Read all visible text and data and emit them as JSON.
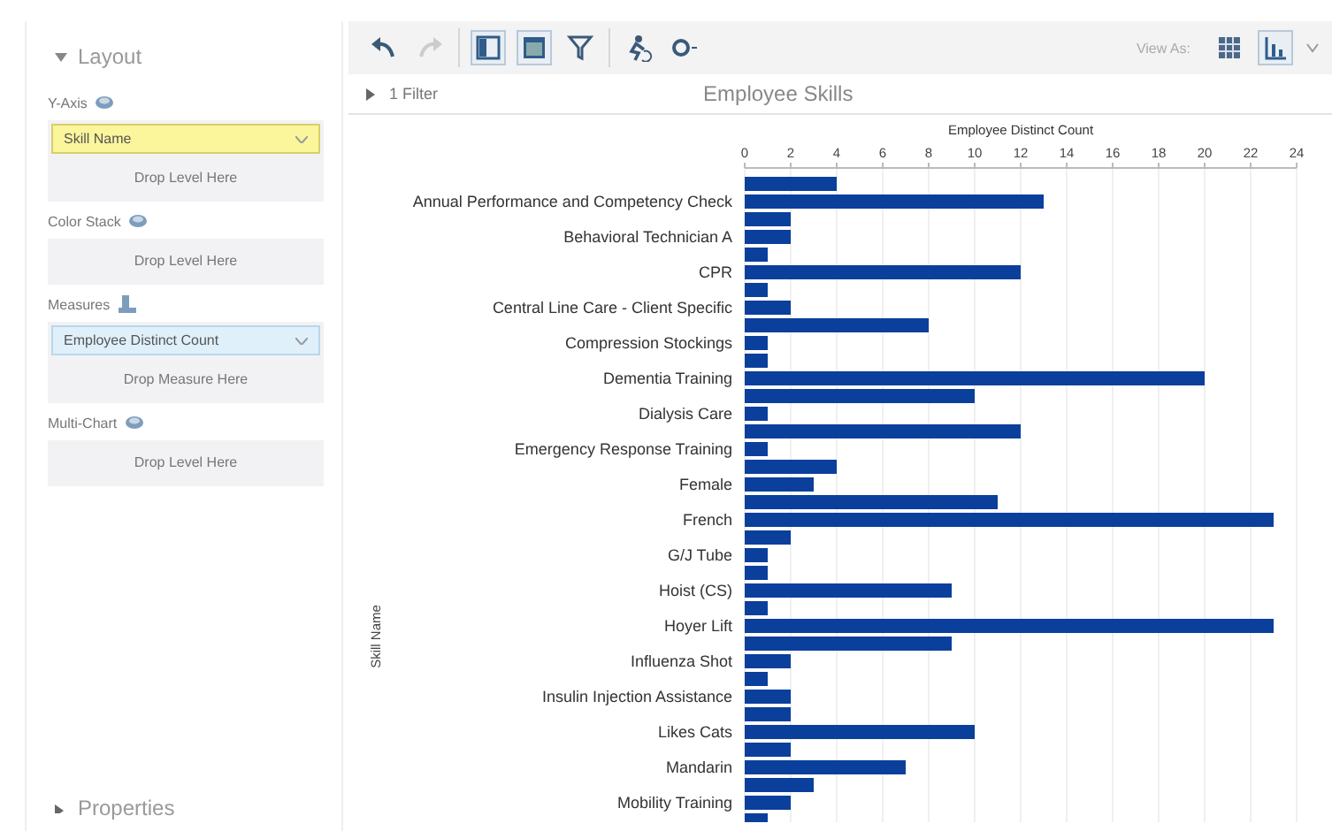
{
  "layout_panel": {
    "title": "Layout",
    "expanded": true,
    "sections": [
      {
        "label": "Y-Axis",
        "kind": "level",
        "items": [
          {
            "label": "Skill Name",
            "kind": "level"
          }
        ],
        "drop_text": "Drop Level Here"
      },
      {
        "label": "Color Stack",
        "kind": "level",
        "drop_text": "Drop Level Here"
      },
      {
        "label": "Measures",
        "kind": "measure",
        "items": [
          {
            "label": "Employee Distinct Count",
            "kind": "measure"
          }
        ],
        "drop_text": "Drop Measure Here"
      },
      {
        "label": "Multi-Chart",
        "kind": "level",
        "drop_text": "Drop Level Here"
      }
    ]
  },
  "properties_panel": {
    "title": "Properties",
    "expanded": false
  },
  "toolbar": {
    "buttons": [
      {
        "kind": "undo",
        "disabled": false,
        "on": false
      },
      {
        "kind": "redo",
        "disabled": true,
        "on": false
      },
      {
        "kind": "sep"
      },
      {
        "kind": "panel",
        "disabled": false,
        "on": true
      },
      {
        "kind": "table",
        "disabled": false,
        "on": true
      },
      {
        "kind": "filter",
        "disabled": false,
        "on": false
      },
      {
        "kind": "sep"
      },
      {
        "kind": "run",
        "disabled": false,
        "on": false
      },
      {
        "kind": "gear",
        "disabled": false,
        "on": false
      }
    ],
    "view_as": "View As:",
    "views": [
      {
        "kind": "grid",
        "selected": false
      },
      {
        "kind": "bar",
        "selected": true
      }
    ]
  },
  "filter_bar": {
    "label": "1 Filter",
    "expanded": false
  },
  "chart_data": {
    "type": "bar",
    "orientation": "horizontal",
    "title": "Employee Skills",
    "xlabel": "Employee Distinct Count",
    "ylabel": "Skill Name",
    "categories": [
      null,
      "Annual Performance and Competency Check",
      null,
      "Behavioral Technician A",
      null,
      "CPR",
      null,
      "Central Line Care - Client Specific",
      null,
      "Compression Stockings",
      null,
      "Dementia Training",
      null,
      "Dialysis Care",
      null,
      "Emergency Response Training",
      null,
      "Female",
      null,
      "French",
      null,
      "G/J Tube",
      null,
      "Hoist (CS)",
      null,
      "Hoyer Lift",
      null,
      "Influenza Shot",
      null,
      "Insulin Injection Assistance",
      null,
      "Likes Cats",
      null,
      "Mandarin",
      null,
      "Mobility Training",
      null
    ],
    "grid": true,
    "series": [
      {
        "color": "#0b3f9c",
        "values": [
          4,
          13,
          2,
          2,
          1,
          12,
          1,
          2,
          8,
          1,
          1,
          20,
          10,
          1,
          12,
          1,
          4,
          3,
          11,
          23,
          2,
          1,
          1,
          9,
          1,
          23,
          9,
          2,
          1,
          2,
          2,
          10,
          2,
          7,
          3,
          2,
          1
        ]
      }
    ],
    "xlim": [
      0,
      24
    ],
    "xticks": [
      0,
      2,
      4,
      6,
      8,
      10,
      12,
      14,
      16,
      18,
      20,
      22,
      24
    ]
  }
}
